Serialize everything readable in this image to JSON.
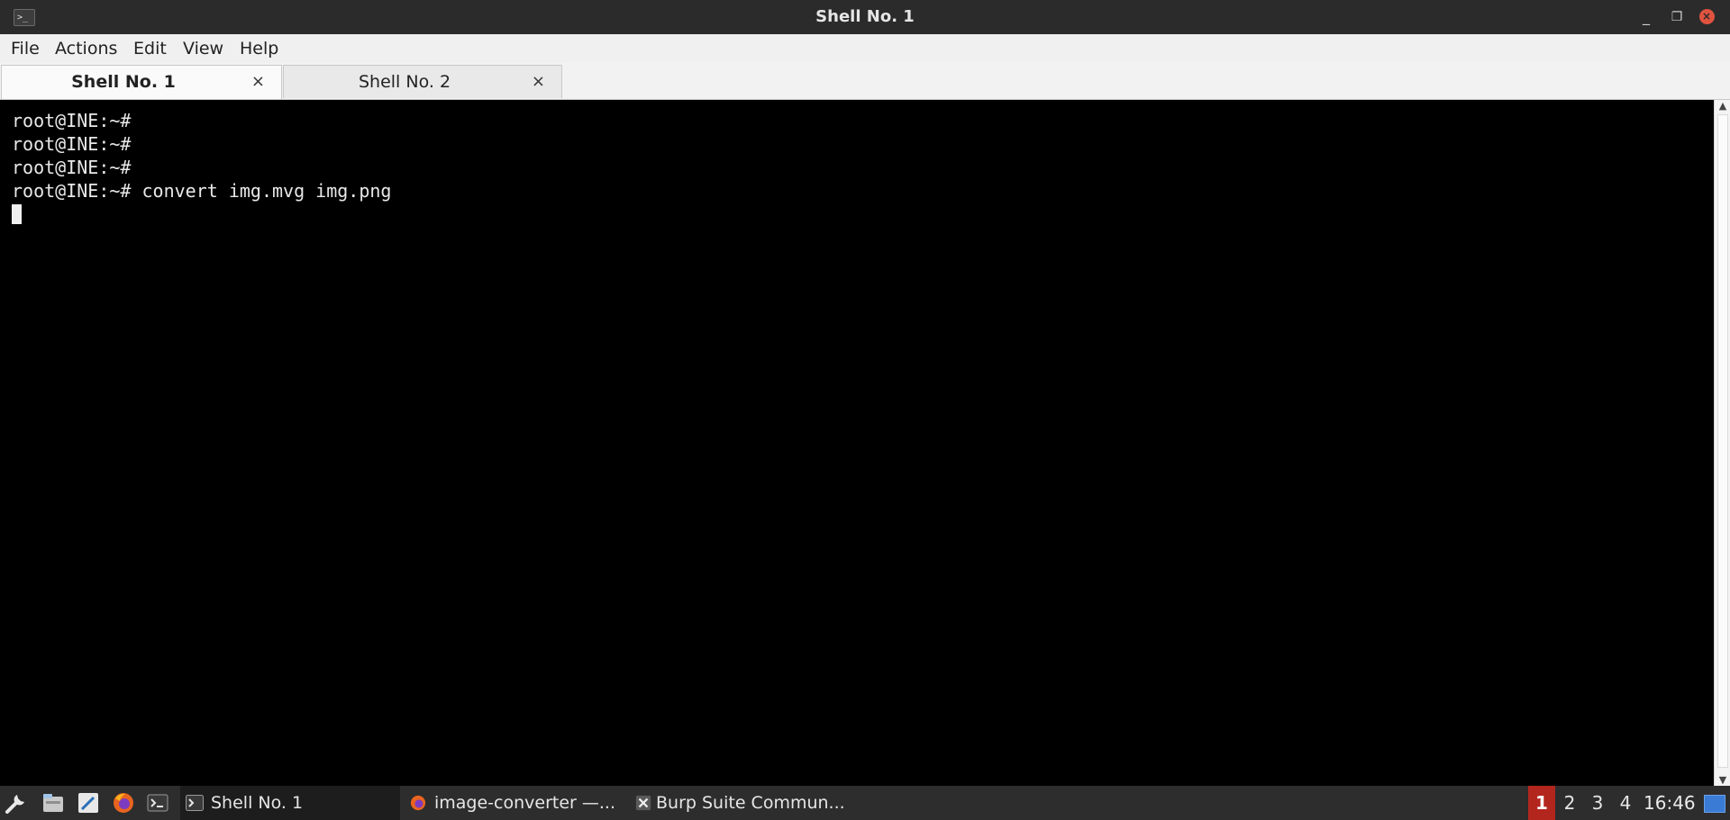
{
  "window": {
    "title": "Shell No. 1",
    "app_icon_glyph": ">_",
    "minimize_glyph": "_",
    "maximize_glyph": "❐",
    "close_glyph": "×",
    "accent_close": "#e0533f"
  },
  "menubar": {
    "items": [
      {
        "label": "File"
      },
      {
        "label": "Actions"
      },
      {
        "label": "Edit"
      },
      {
        "label": "View"
      },
      {
        "label": "Help"
      }
    ]
  },
  "tabs": [
    {
      "label": "Shell No. 1",
      "active": true,
      "close": "×"
    },
    {
      "label": "Shell No. 2",
      "active": false,
      "close": "×"
    }
  ],
  "terminal": {
    "lines": [
      "root@INE:~#",
      "root@INE:~#",
      "root@INE:~#",
      "root@INE:~# convert img.mvg img.png"
    ],
    "cursor_visible": true
  },
  "scrollbar": {
    "up_glyph": "▲",
    "down_glyph": "▼"
  },
  "taskbar": {
    "launchers": [
      {
        "icon": "settings-tool-icon"
      },
      {
        "icon": "file-manager-icon"
      },
      {
        "icon": "text-editor-icon"
      },
      {
        "icon": "firefox-icon"
      },
      {
        "icon": "terminal-icon"
      }
    ],
    "tasks": [
      {
        "label": "Shell No. 1",
        "icon": "terminal-icon",
        "active": true
      },
      {
        "label": "image-converter —...",
        "icon": "firefox-icon",
        "active": false
      },
      {
        "label": "Burp Suite Commun...",
        "icon": "close-x-icon",
        "active": false
      }
    ],
    "workspaces": [
      "1",
      "2",
      "3",
      "4"
    ],
    "active_workspace": "1",
    "clock": "16:46",
    "workspace_active_color": "#b3261e"
  }
}
